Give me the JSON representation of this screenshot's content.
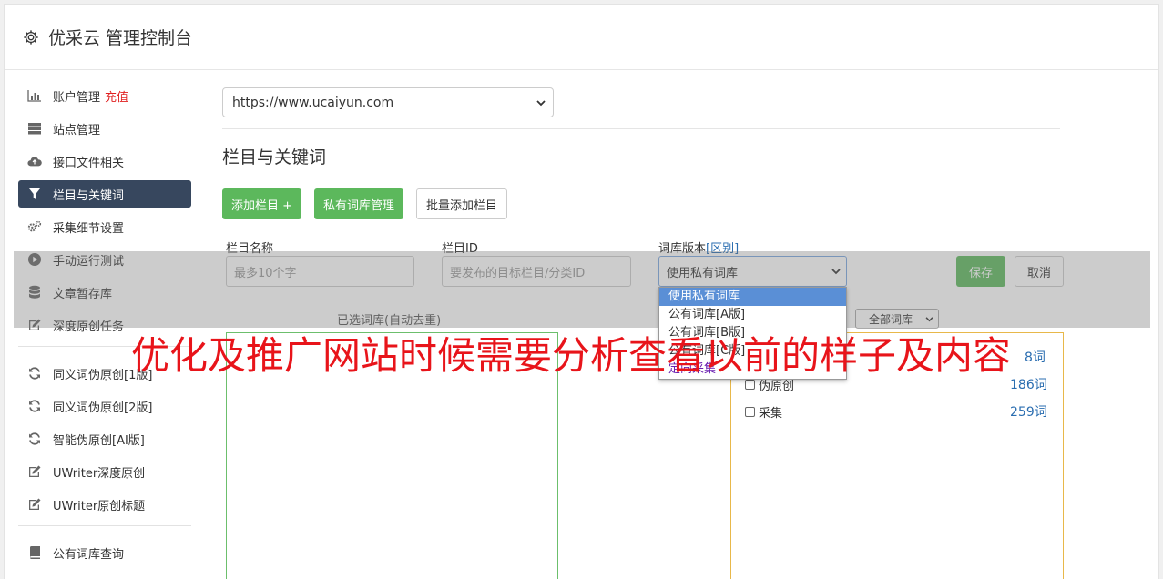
{
  "header": {
    "title": "优采云 管理控制台",
    "icon": "gear-icon"
  },
  "sidebar": {
    "items": [
      {
        "label": "账户管理",
        "extra": "充值",
        "icon": "bar-chart-icon"
      },
      {
        "label": "站点管理",
        "icon": "server-icon"
      },
      {
        "label": "接口文件相关",
        "icon": "cloud-upload-icon"
      },
      {
        "label": "栏目与关键词",
        "icon": "filter-icon",
        "active": true
      },
      {
        "label": "采集细节设置",
        "icon": "gears-icon"
      },
      {
        "label": "手动运行测试",
        "icon": "play-circle-icon"
      },
      {
        "label": "文章暂存库",
        "icon": "database-icon"
      },
      {
        "label": "深度原创任务",
        "icon": "edit-icon"
      },
      {
        "label": "同义词伪原创[1版]",
        "icon": "refresh-icon"
      },
      {
        "label": "同义词伪原创[2版]",
        "icon": "refresh-icon"
      },
      {
        "label": "智能伪原创[AI版]",
        "icon": "refresh-icon"
      },
      {
        "label": "UWriter深度原创",
        "icon": "edit-icon"
      },
      {
        "label": "UWriter原创标题",
        "icon": "edit-icon"
      },
      {
        "label": "公有词库查询",
        "icon": "book-icon"
      }
    ]
  },
  "main": {
    "site_select": "https://www.ucaiyun.com",
    "section_title": "栏目与关键词",
    "buttons": {
      "add": "添加栏目 +",
      "private": "私有词库管理",
      "batch": "批量添加栏目"
    },
    "form": {
      "name_label": "栏目名称",
      "name_placeholder": "最多10个字",
      "id_label": "栏目ID",
      "id_placeholder": "要发布的目标栏目/分类ID",
      "version_label": "词库版本",
      "version_link": "[区别]",
      "version_value": "使用私有词库",
      "save": "保存",
      "cancel": "取消"
    },
    "dropdown_options": [
      "使用私有词库",
      "公有词库[A版]",
      "公有词库[B版]",
      "公有词库[C版]",
      "定向采集"
    ],
    "selected_title": "已选词库(自动去重)",
    "filter_select": "全部词库",
    "keywords": [
      {
        "label": "伪原创",
        "count": "186词"
      },
      {
        "label": "采集",
        "count": "259词"
      }
    ],
    "partial_count": "8词"
  },
  "watermark": "优化及推广网站时候需要分析查看以前的样子及内容",
  "colors": {
    "green": "#5cb85c",
    "nav_active": "#37475e",
    "link": "#2a6db0",
    "red": "#e8141a"
  }
}
